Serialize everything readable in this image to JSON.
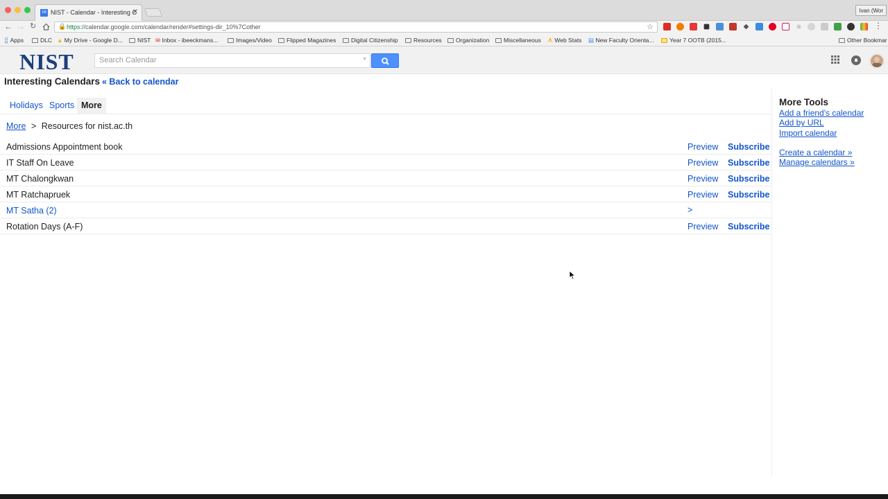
{
  "browser": {
    "tab_title": "NIST - Calendar - Interesting C",
    "tab_favicon": "16",
    "profile_name": "Ivan (Wor",
    "url_scheme": "https://",
    "url_rest": "calendar.google.com/calendar/render#settings-dir_10%7Cother",
    "bookmarks": [
      {
        "label": "Apps",
        "icon": "apps-grid-icon"
      },
      {
        "label": "DLC",
        "icon": "folder-icon"
      },
      {
        "label": "My Drive - Google D...",
        "icon": "drive-icon"
      },
      {
        "label": "NIST",
        "icon": "folder-icon"
      },
      {
        "label": "Inbox - ibeeckmans...",
        "icon": "gmail-icon"
      },
      {
        "label": "Images/Video",
        "icon": "folder-icon"
      },
      {
        "label": "Flipped Magazines",
        "icon": "folder-icon"
      },
      {
        "label": "Digital Citizenship",
        "icon": "folder-icon"
      },
      {
        "label": "Resources",
        "icon": "folder-icon"
      },
      {
        "label": "Organization",
        "icon": "folder-icon"
      },
      {
        "label": "Miscellaneous",
        "icon": "folder-icon"
      },
      {
        "label": "Web Stats",
        "icon": "stats-icon"
      },
      {
        "label": "New Faculty Orienta...",
        "icon": "doc-icon"
      },
      {
        "label": "Year 7 OOTB (2015...",
        "icon": "folder-icon"
      }
    ],
    "other_bookmarks": "Other Bookmar"
  },
  "header": {
    "logo_text": "NIST",
    "search_placeholder": "Search Calendar"
  },
  "page": {
    "title": "Interesting Calendars",
    "back_link": "« Back to calendar",
    "tabs": [
      "Holidays",
      "Sports",
      "More"
    ],
    "active_tab": "More",
    "breadcrumb_link": "More",
    "breadcrumb_sep": ">",
    "breadcrumb_current": "Resources for nist.ac.th",
    "preview_label": "Preview",
    "subscribe_label": "Subscribe",
    "calendars": [
      {
        "name": "Admissions Appointment book",
        "type": "calendar"
      },
      {
        "name": "IT Staff On Leave",
        "type": "calendar"
      },
      {
        "name": "MT Chalongkwan",
        "type": "calendar"
      },
      {
        "name": "MT Ratchapruek",
        "type": "calendar"
      },
      {
        "name": "MT Satha (2)",
        "type": "folder",
        "arrow": ">"
      },
      {
        "name": "Rotation Days (A-F)",
        "type": "calendar"
      }
    ]
  },
  "more_tools": {
    "heading": "More Tools",
    "links_group1": [
      "Add a friend's calendar",
      "Add by URL",
      "Import calendar"
    ],
    "links_group2": [
      "Create a calendar »",
      "Manage calendars »"
    ]
  },
  "colors": {
    "link": "#1155cc",
    "search_button": "#4d90fe",
    "logo": "#1e3d7b"
  }
}
